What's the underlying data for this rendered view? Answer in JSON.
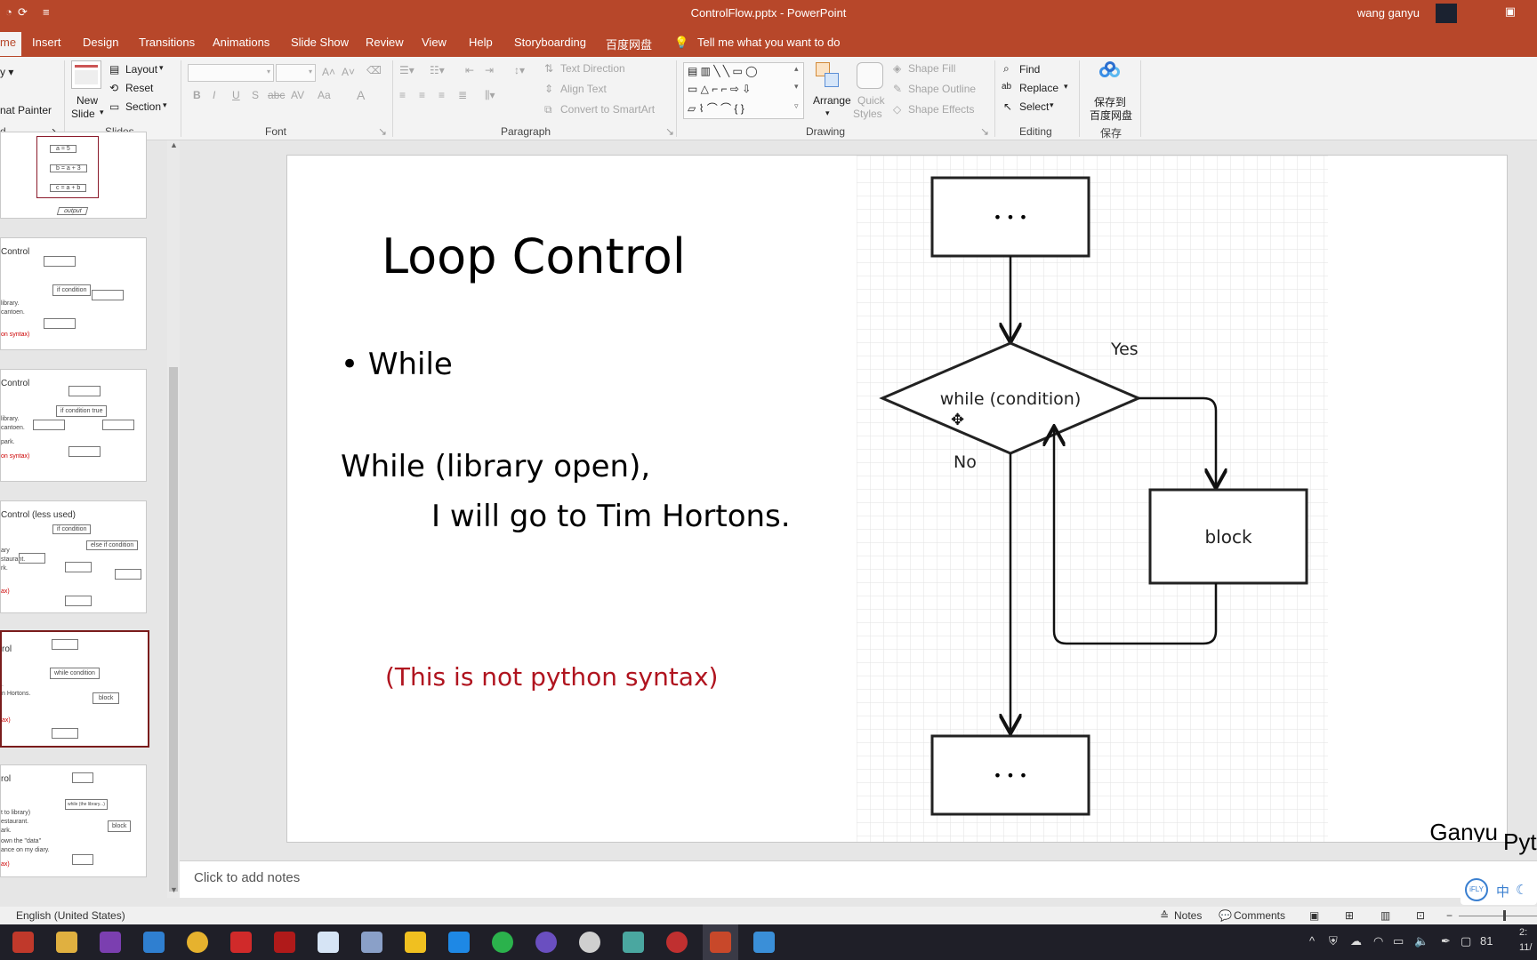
{
  "window": {
    "title": "ControlFlow.pptx  -  PowerPoint",
    "user": "wang ganyu"
  },
  "tabs": [
    "me",
    "Insert",
    "Design",
    "Transitions",
    "Animations",
    "Slide Show",
    "Review",
    "View",
    "Help",
    "Storyboarding",
    "百度网盘"
  ],
  "tell_me": "Tell me what you want to do",
  "ribbon": {
    "clipboard": {
      "painter": "nat Painter",
      "label": "d"
    },
    "slides": {
      "new_slide_line1": "New",
      "new_slide_line2": "Slide",
      "layout": "Layout",
      "reset": "Reset",
      "section": "Section",
      "label": "Slides"
    },
    "font": {
      "label": "Font",
      "bold": "B",
      "italic": "I",
      "underline": "U",
      "strike": "S",
      "abc": "abc",
      "av": "AV",
      "aa": "Aa",
      "fontcolor": "A"
    },
    "paragraph": {
      "label": "Paragraph",
      "text_direction": "Text Direction",
      "align_text": "Align Text",
      "smartart": "Convert to SmartArt"
    },
    "drawing": {
      "label": "Drawing",
      "arrange": "Arrange",
      "quick_styles_1": "Quick",
      "quick_styles_2": "Styles",
      "shape_fill": "Shape Fill",
      "shape_outline": "Shape Outline",
      "shape_effects": "Shape Effects"
    },
    "editing": {
      "label": "Editing",
      "find": "Find",
      "replace": "Replace",
      "select": "Select"
    },
    "save": {
      "line1": "保存到",
      "line2": "百度网盘",
      "label": "保存"
    }
  },
  "thumbnails": [
    {
      "title": "",
      "lines": [
        "a = 5",
        "b = a + 3",
        "c = a + b"
      ],
      "red": ""
    },
    {
      "title": "Control",
      "lines": [
        "if condition",
        "library.",
        "cantoen."
      ],
      "red": "on syntax)"
    },
    {
      "title": "Control",
      "lines": [
        "if condition true",
        "library.",
        "cantoen.",
        "park."
      ],
      "red": "on syntax)"
    },
    {
      "title": "Control (less used)",
      "lines": [
        "if condition",
        "else if condition",
        "ary",
        "staurant.",
        "rk."
      ],
      "red": "ax)"
    },
    {
      "title": "rol",
      "lines": [
        "while condition",
        "block",
        ".",
        "n Hortons."
      ],
      "red": "ax)"
    },
    {
      "title": "rol",
      "lines": [
        "while (the library...)",
        "block",
        "t to library)",
        "estaurant.",
        "ark.",
        "own the \"data\"",
        "ance on my diary."
      ],
      "red": "ax)"
    }
  ],
  "slide": {
    "title": "Loop Control",
    "bullet": "While",
    "line1": "While (library open),",
    "line2": "I will go to Tim Hortons.",
    "red_note": "(This is not python syntax)",
    "flow": {
      "top_box": "• • •",
      "condition": "while (condition)",
      "yes": "Yes",
      "no": "No",
      "block": "block",
      "bottom_box": "• • •"
    },
    "signature_1": "Ganyu",
    "signature_2": "Pyth"
  },
  "notes_placeholder": "Click to add notes",
  "status": {
    "language": "English (United States)",
    "notes": "Notes",
    "comments": "Comments"
  },
  "ifly": {
    "logo": "iFLY",
    "lang": "中"
  },
  "tray": {
    "battery": "81",
    "time": "2:",
    "date": "11/"
  }
}
